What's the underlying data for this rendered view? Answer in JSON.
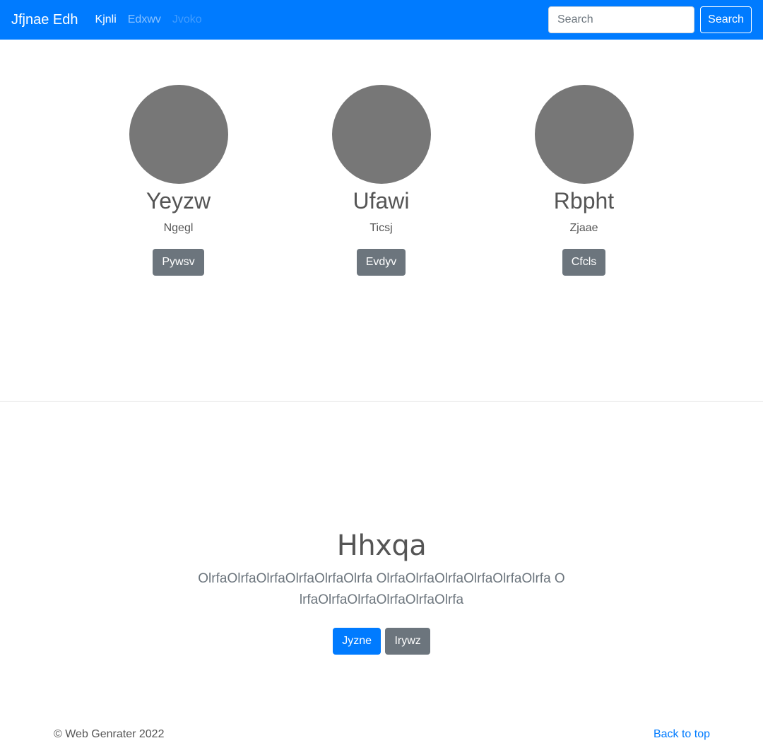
{
  "navbar": {
    "brand": "Jfjnae Edh",
    "links": [
      {
        "label": "Kjnli",
        "state": "active"
      },
      {
        "label": "Edxwv",
        "state": "normal"
      },
      {
        "label": "Jvoko",
        "state": "disabled"
      }
    ],
    "search_placeholder": "Search",
    "search_button": "Search",
    "bg_color": "#007bff"
  },
  "profiles": [
    {
      "name": "Yeyzw",
      "subtitle": "Ngegl",
      "button": "Pywsv"
    },
    {
      "name": "Ufawi",
      "subtitle": "Ticsj",
      "button": "Evdyv"
    },
    {
      "name": "Rbpht",
      "subtitle": "Zjaae",
      "button": "Cfcls"
    }
  ],
  "jumbotron": {
    "title": "Hhxqa",
    "text": "OlrfaOlrfaOlrfaOlrfaOlrfaOlrfa OlrfaOlrfaOlrfaOlrfaOlrfaOlrfa OlrfaOlrfaOlrfaOlrfaOlrfaOlrfa",
    "primary_button": "Jyzne",
    "secondary_button": "Irywz"
  },
  "footer": {
    "copyright": "© Web Genrater 2022",
    "back_to_top": "Back to top"
  },
  "colors": {
    "primary": "#007bff",
    "secondary": "#6c757d",
    "avatar": "#777777"
  }
}
